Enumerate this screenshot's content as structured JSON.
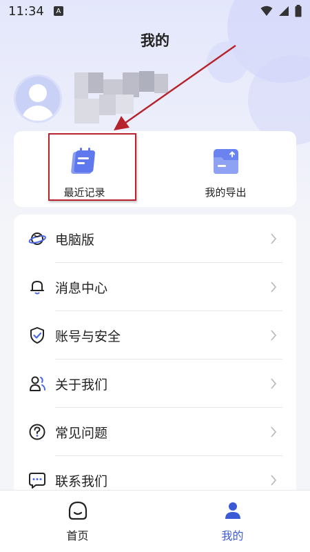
{
  "status_bar": {
    "time": "11:34",
    "badge": "A"
  },
  "header": {
    "title": "我的"
  },
  "quick_actions": [
    {
      "label": "最近记录",
      "icon": "calendar-notes-icon"
    },
    {
      "label": "我的导出",
      "icon": "export-folder-icon"
    }
  ],
  "menu": [
    {
      "label": "电脑版",
      "icon": "planet-icon"
    },
    {
      "label": "消息中心",
      "icon": "bell-icon"
    },
    {
      "label": "账号与安全",
      "icon": "shield-check-icon"
    },
    {
      "label": "关于我们",
      "icon": "people-icon"
    },
    {
      "label": "常见问题",
      "icon": "question-icon"
    },
    {
      "label": "联系我们",
      "icon": "chat-icon"
    }
  ],
  "tabs": [
    {
      "label": "首页",
      "icon": "home-face-icon",
      "active": false
    },
    {
      "label": "我的",
      "icon": "user-icon",
      "active": true
    }
  ],
  "colors": {
    "accent": "#3b5bd6",
    "highlight": "#b7232c",
    "background": "#f4f5f9"
  }
}
